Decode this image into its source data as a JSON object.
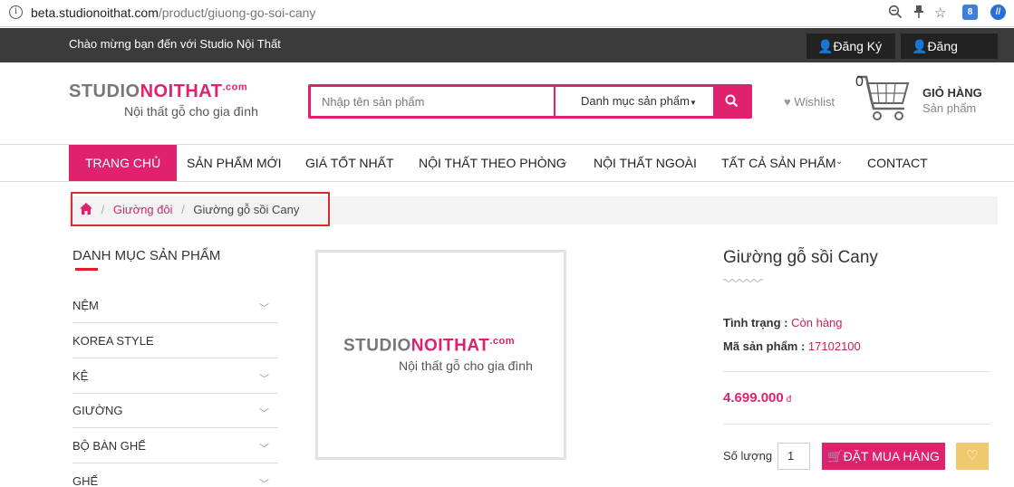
{
  "browser": {
    "url_host": "beta.studionoithat.com",
    "url_path": "/product/giuong-go-soi-cany"
  },
  "topbar": {
    "welcome": "Chào mừng bạn đến với Studio Nội Thất",
    "register": "Đăng Ký",
    "login": "Đăng Nhập"
  },
  "logo": {
    "part1": "STUDIO",
    "part2": "NOITHAT",
    "tld": ".com",
    "tagline": "Nội thất gỗ cho gia đình"
  },
  "search": {
    "placeholder": "Nhập tên sản phẩm",
    "category": "Danh mục sản phẩm"
  },
  "header": {
    "wishlist": "Wishlist",
    "cart_title": "GIỎ HÀNG",
    "cart_sub": "Sản phẩm",
    "cart_count": "0"
  },
  "nav": {
    "items": [
      "TRANG CHỦ",
      "SẢN PHẨM MỚI",
      "GIÁ TỐT NHẤT",
      "NỘI THẤT THEO PHÒNG",
      "NỘI THẤT NGOÀI",
      "TẤT CẢ SẢN PHẨM",
      "CONTACT"
    ]
  },
  "breadcrumb": {
    "category": "Giường đôi",
    "current": "Giường gỗ sồi Cany"
  },
  "sidebar": {
    "title": "DANH MỤC SẢN PHẨM",
    "items": [
      "NỆM",
      "KOREA STYLE",
      "KỆ",
      "GIƯỜNG",
      "BỘ BÀN GHẾ",
      "GHẾ"
    ]
  },
  "product": {
    "name": "Giường gỗ sồi Cany",
    "status_label": "Tình trạng :",
    "status_value": "Còn hàng",
    "sku_label": "Mã sản phẩm :",
    "sku_value": "17102100",
    "price": "4.699.000",
    "currency": "đ",
    "qty_label": "Số lượng",
    "qty_value": "1",
    "buy_label": "ĐẶT MUA HÀNG"
  },
  "colors": {
    "accent": "#e0216e",
    "topbar": "#3b3b3b",
    "highlight_box": "#d82c32",
    "wishlist_btn": "#f0c86e"
  }
}
